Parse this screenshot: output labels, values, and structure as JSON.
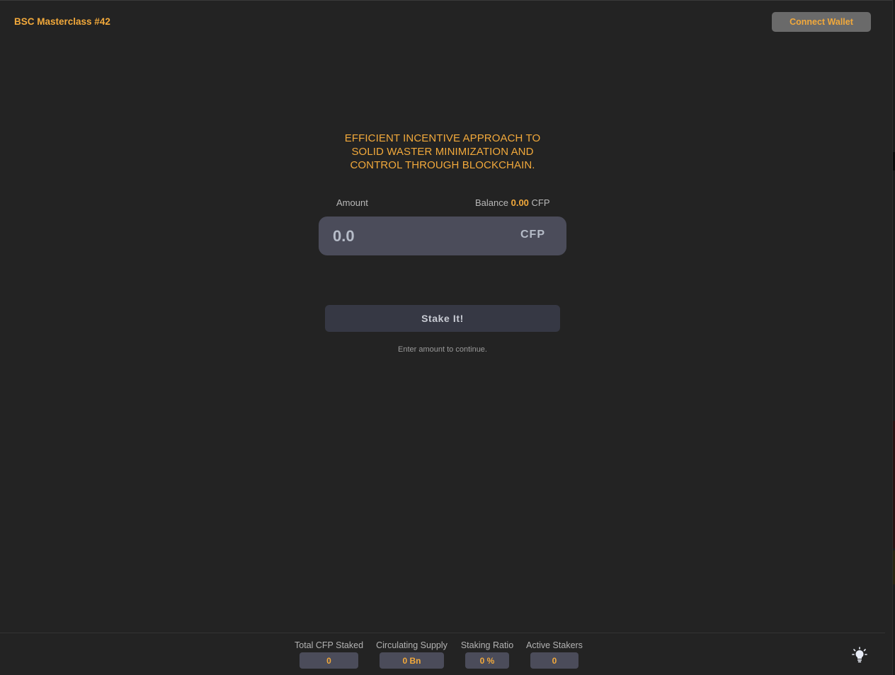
{
  "header": {
    "brand": "BSC Masterclass #42",
    "connect_wallet_label": "Connect Wallet"
  },
  "hero": {
    "headline_lines": [
      "EFFICIENT INCENTIVE APPROACH TO",
      "SOLID WASTER MINIMIZATION AND",
      "CONTROL THROUGH BLOCKCHAIN."
    ]
  },
  "stake_form": {
    "amount_label": "Amount",
    "balance_label": "Balance",
    "balance_value": "0.00",
    "balance_unit": "CFP",
    "amount_placeholder": "0.0",
    "amount_value": "",
    "unit": "CFP",
    "stake_button_label": "Stake It!",
    "hint": "Enter amount to continue."
  },
  "stats": [
    {
      "label": "Total CFP Staked",
      "value": "0"
    },
    {
      "label": "Circulating Supply",
      "value": "0 Bn"
    },
    {
      "label": "Staking Ratio",
      "value": "0 %"
    },
    {
      "label": "Active Stakers",
      "value": "0"
    }
  ],
  "theme_toggle_icon": "lightbulb-icon",
  "colors": {
    "background": "#232323",
    "accent": "#f2a93b",
    "input_bg": "#4b4c5a",
    "button_bg": "#363844"
  }
}
